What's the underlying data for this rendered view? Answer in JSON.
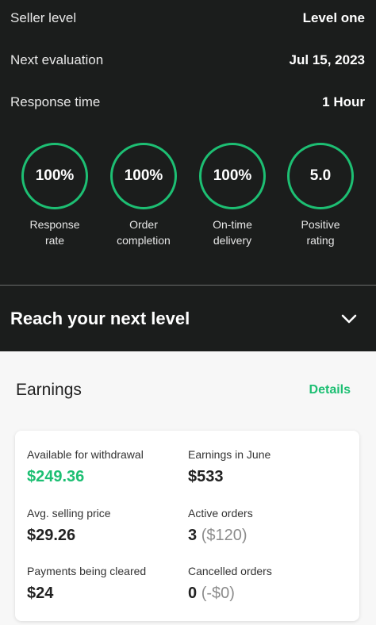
{
  "seller": {
    "level_label": "Seller level",
    "level_value": "Level one",
    "evaluation_label": "Next evaluation",
    "evaluation_value": "Jul 15, 2023",
    "response_label": "Response time",
    "response_value": "1 Hour"
  },
  "stats": [
    {
      "value": "100%",
      "label_line1": "Response",
      "label_line2": "rate"
    },
    {
      "value": "100%",
      "label_line1": "Order",
      "label_line2": "completion"
    },
    {
      "value": "100%",
      "label_line1": "On-time",
      "label_line2": "delivery"
    },
    {
      "value": "5.0",
      "label_line1": "Positive",
      "label_line2": "rating"
    }
  ],
  "reach": {
    "title": "Reach your next level"
  },
  "earnings": {
    "title": "Earnings",
    "details_label": "Details",
    "available_label": "Available for withdrawal",
    "available_value": "$249.36",
    "june_label": "Earnings in June",
    "june_value": "$533",
    "avg_label": "Avg. selling price",
    "avg_value": "$29.26",
    "active_label": "Active orders",
    "active_count": "3",
    "active_amount": "($120)",
    "cleared_label": "Payments being cleared",
    "cleared_value": "$24",
    "cancelled_label": "Cancelled orders",
    "cancelled_count": "0",
    "cancelled_amount": "(-$0)"
  },
  "colors": {
    "accent": "#1dbf73",
    "dark_bg": "#1b1d1c"
  }
}
